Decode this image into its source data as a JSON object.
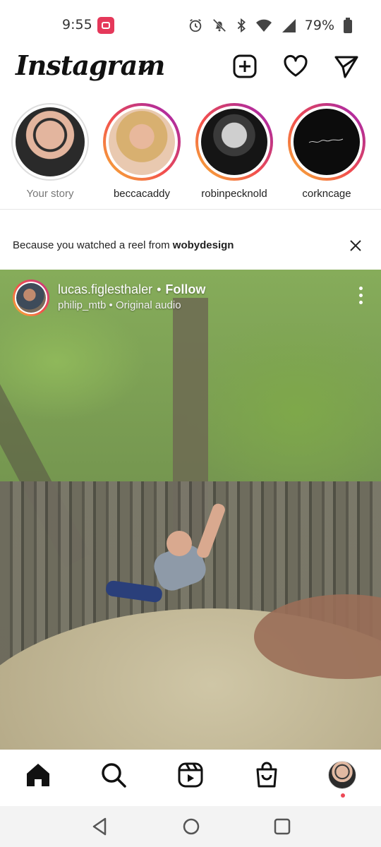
{
  "status_bar": {
    "time": "9:55",
    "battery_percent": "79%",
    "icons": [
      "screen-record-icon",
      "alarm-icon",
      "mute-icon",
      "bluetooth-icon",
      "wifi-icon",
      "signal-icon",
      "battery-icon"
    ]
  },
  "header": {
    "brand": "Instagram",
    "icons": [
      "chevron-down-icon",
      "new-post-icon",
      "heart-icon",
      "direct-message-icon"
    ]
  },
  "stories": [
    {
      "username": "Your story",
      "seen": true
    },
    {
      "username": "beccacaddy",
      "seen": false
    },
    {
      "username": "robinpecknold",
      "seen": false
    },
    {
      "username": "corkncage",
      "seen": false
    }
  ],
  "suggestion": {
    "prefix": "Because you watched a reel from ",
    "account": "wobydesign"
  },
  "reel": {
    "username": "lucas.figlesthaler",
    "separator": "•",
    "follow_label": "Follow",
    "audio_account": "philip_mtb",
    "audio_label": "Original audio"
  },
  "bottom_nav": {
    "items": [
      "home-icon",
      "search-icon",
      "reels-icon",
      "shop-icon",
      "profile-avatar"
    ],
    "active": "home-icon",
    "notification_dot_color": "#ed4956"
  },
  "system_nav": [
    "back-icon",
    "home-circle-icon",
    "recents-icon"
  ],
  "colors": {
    "story_ring_gradient": [
      "#f7b733",
      "#f24e4e",
      "#c13584",
      "#a020c0"
    ],
    "record_badge": "#e5385a"
  }
}
